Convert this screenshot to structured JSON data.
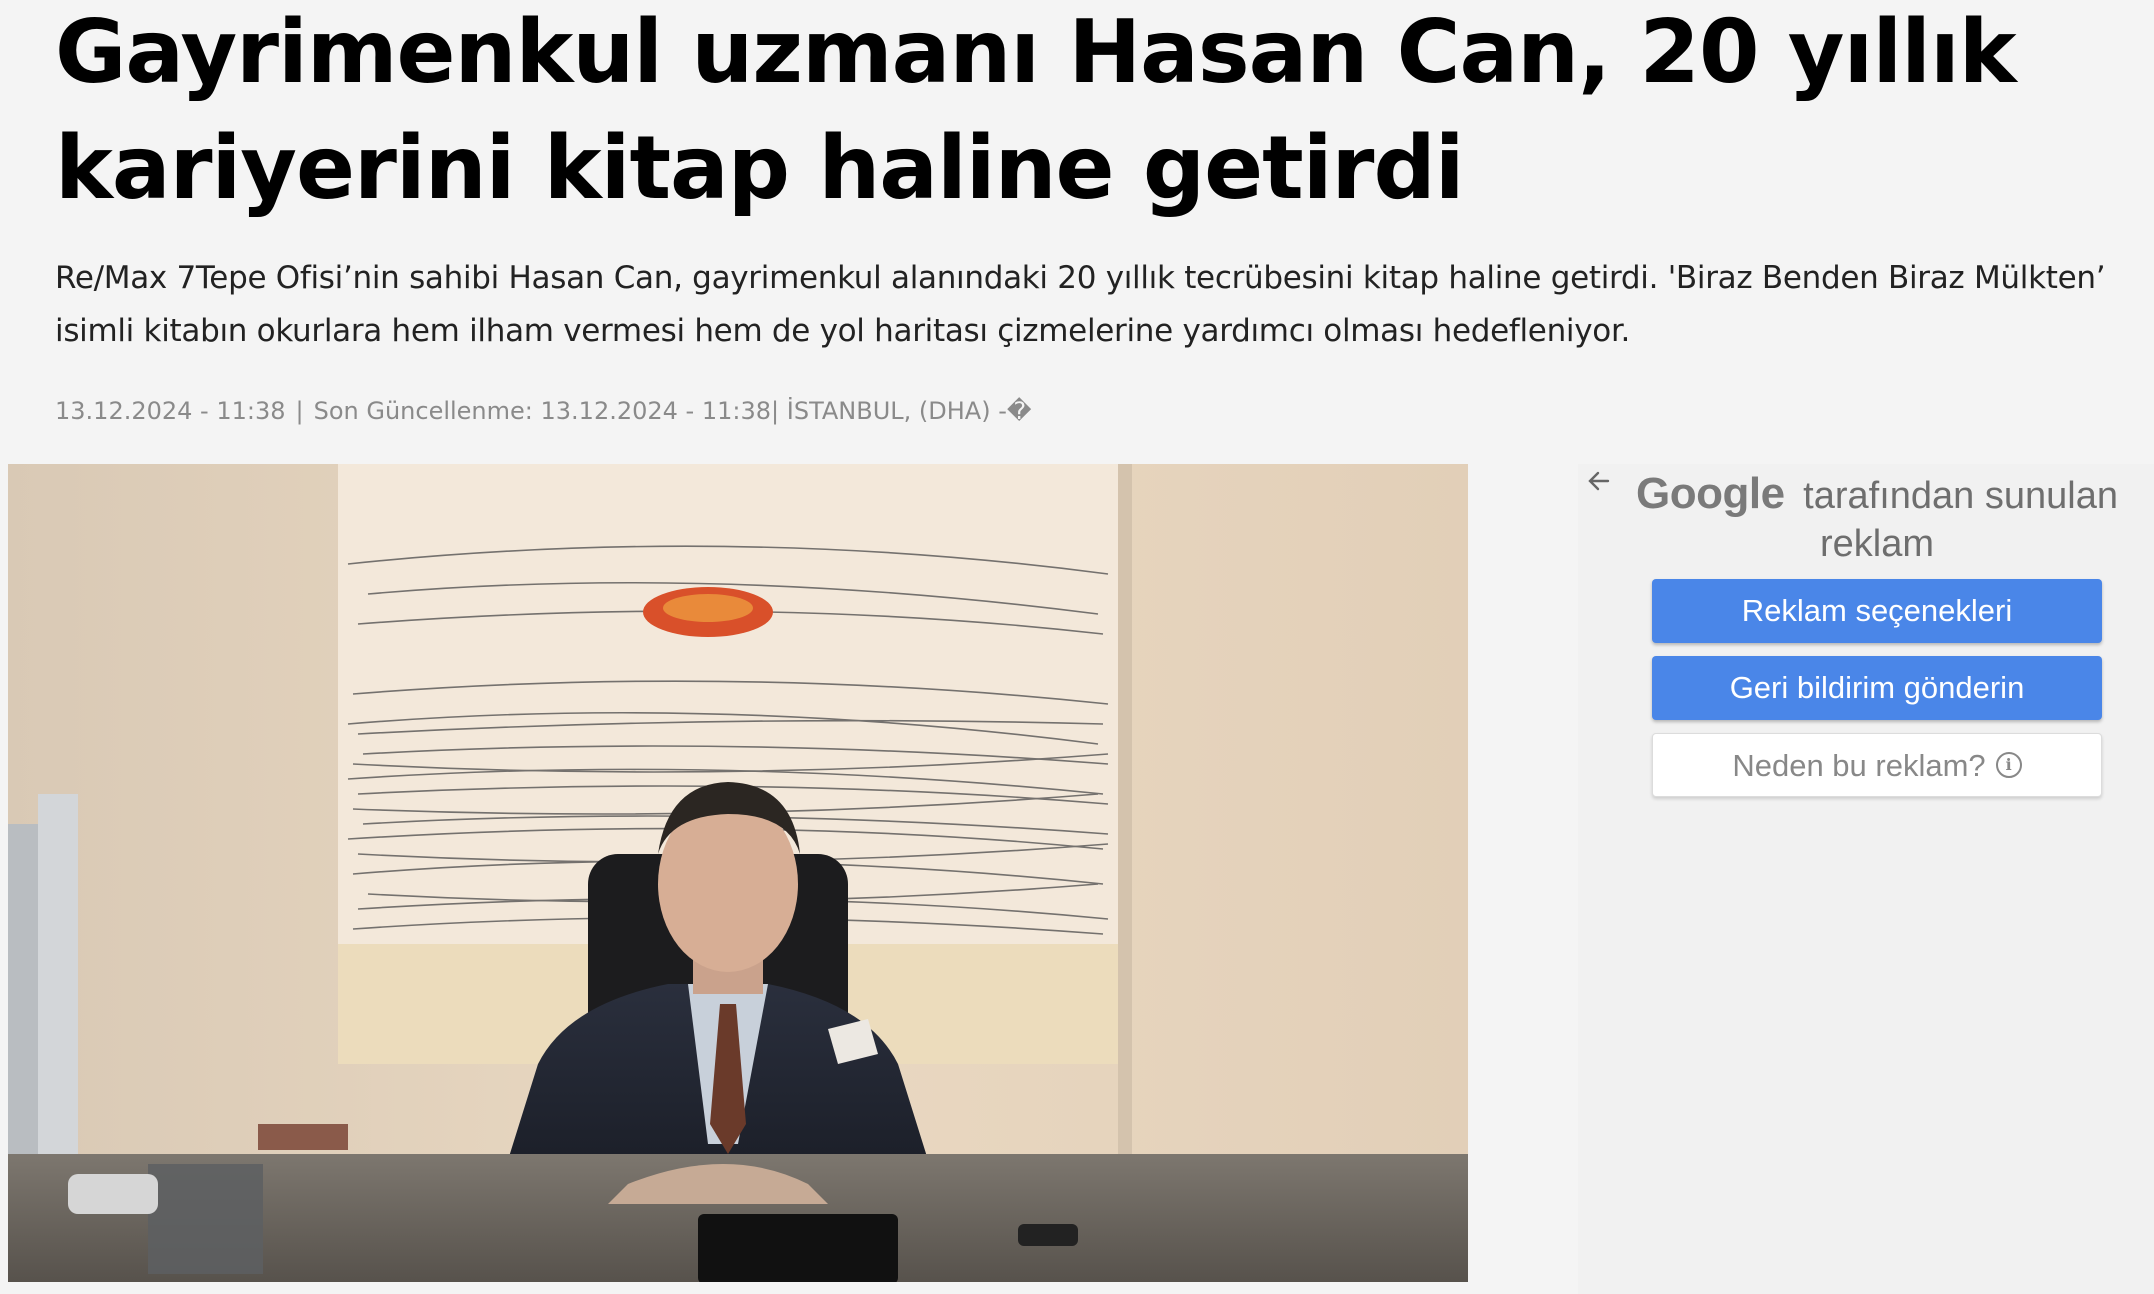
{
  "article": {
    "headline": "Gayrimenkul uzmanı Hasan Can, 20 yıllık kariyerini kitap haline getirdi",
    "summary": "Re/Max 7Tepe Ofisi’nin sahibi Hasan Can, gayrimenkul alanındaki 20 yıllık tecrübesini kitap haline getirdi. 'Biraz Benden Biraz Mülkten’ isimli kitabın okurlara hem ilham vermesi hem de yol haritası çizmelerine yardımcı olması hedefleniyor.",
    "meta": {
      "published": "13.12.2024 - 11:38",
      "separator": "|",
      "updated_label": "Son Güncellenme:",
      "updated": "13.12.2024 - 11:38",
      "location_separator": "|",
      "location_source": "İSTANBUL, (DHA) -�"
    },
    "photo": {
      "subject": "man-in-suit-at-desk"
    }
  },
  "ad_panel": {
    "back_icon": "arrow-left-icon",
    "google_logo_text": "Google",
    "title_text": "tarafından sunulan reklam",
    "buttons": {
      "options": "Reklam seçenekleri",
      "feedback": "Geri bildirim gönderin",
      "why": "Neden bu reklam?"
    },
    "info_icon": "info-icon",
    "colors": {
      "primary_button": "#4a86e8",
      "panel_bg": "#f1f1f1"
    }
  }
}
